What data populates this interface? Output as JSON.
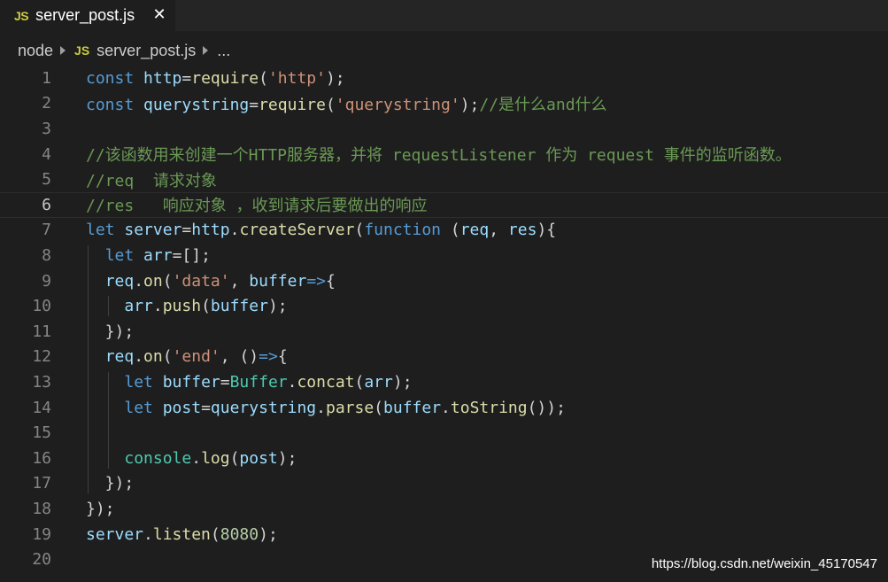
{
  "tab": {
    "badge": "JS",
    "filename": "server_post.js",
    "close_glyph": "✕"
  },
  "breadcrumb": {
    "folder": "node",
    "badge": "JS",
    "file": "server_post.js",
    "more": "..."
  },
  "lines": [
    {
      "n": "1",
      "tokens": [
        [
          "kw",
          "const "
        ],
        [
          "var",
          "http"
        ],
        [
          "pun",
          "="
        ],
        [
          "fn",
          "require"
        ],
        [
          "pun",
          "("
        ],
        [
          "str",
          "'http'"
        ],
        [
          "pun",
          ");"
        ]
      ]
    },
    {
      "n": "2",
      "tokens": [
        [
          "kw",
          "const "
        ],
        [
          "var",
          "querystring"
        ],
        [
          "pun",
          "="
        ],
        [
          "fn",
          "require"
        ],
        [
          "pun",
          "("
        ],
        [
          "str",
          "'querystring'"
        ],
        [
          "pun",
          ");"
        ],
        [
          "cmt",
          "//是什么and什么"
        ]
      ]
    },
    {
      "n": "3",
      "tokens": []
    },
    {
      "n": "4",
      "tokens": [
        [
          "cmt",
          "//该函数用来创建一个HTTP服务器，并将 requestListener 作为 request 事件的监听函数。"
        ]
      ]
    },
    {
      "n": "5",
      "tokens": [
        [
          "cmt",
          "//req  请求对象"
        ]
      ]
    },
    {
      "n": "6",
      "tokens": [
        [
          "cmt",
          "//res   响应对象 ，收到请求后要做出的响应"
        ]
      ]
    },
    {
      "n": "7",
      "tokens": [
        [
          "kw",
          "let "
        ],
        [
          "var",
          "server"
        ],
        [
          "pun",
          "="
        ],
        [
          "var",
          "http"
        ],
        [
          "pun",
          "."
        ],
        [
          "fn",
          "createServer"
        ],
        [
          "pun",
          "("
        ],
        [
          "kw",
          "function"
        ],
        [
          "pun",
          " ("
        ],
        [
          "var",
          "req"
        ],
        [
          "pun",
          ", "
        ],
        [
          "var",
          "res"
        ],
        [
          "pun",
          "){"
        ]
      ]
    },
    {
      "n": "8",
      "tokens": [
        [
          "pun",
          "  "
        ],
        [
          "kw",
          "let "
        ],
        [
          "var",
          "arr"
        ],
        [
          "pun",
          "=[];"
        ]
      ]
    },
    {
      "n": "9",
      "tokens": [
        [
          "pun",
          "  "
        ],
        [
          "var",
          "req"
        ],
        [
          "pun",
          "."
        ],
        [
          "fn",
          "on"
        ],
        [
          "pun",
          "("
        ],
        [
          "str",
          "'data'"
        ],
        [
          "pun",
          ", "
        ],
        [
          "var",
          "buffer"
        ],
        [
          "kw",
          "=>"
        ],
        [
          "pun",
          "{"
        ]
      ]
    },
    {
      "n": "10",
      "tokens": [
        [
          "pun",
          "    "
        ],
        [
          "var",
          "arr"
        ],
        [
          "pun",
          "."
        ],
        [
          "fn",
          "push"
        ],
        [
          "pun",
          "("
        ],
        [
          "var",
          "buffer"
        ],
        [
          "pun",
          ");"
        ]
      ]
    },
    {
      "n": "11",
      "tokens": [
        [
          "pun",
          "  });"
        ]
      ]
    },
    {
      "n": "12",
      "tokens": [
        [
          "pun",
          "  "
        ],
        [
          "var",
          "req"
        ],
        [
          "pun",
          "."
        ],
        [
          "fn",
          "on"
        ],
        [
          "pun",
          "("
        ],
        [
          "str",
          "'end'"
        ],
        [
          "pun",
          ", ()"
        ],
        [
          "kw",
          "=>"
        ],
        [
          "pun",
          "{"
        ]
      ]
    },
    {
      "n": "13",
      "tokens": [
        [
          "pun",
          "    "
        ],
        [
          "kw",
          "let "
        ],
        [
          "var",
          "buffer"
        ],
        [
          "pun",
          "="
        ],
        [
          "cls",
          "Buffer"
        ],
        [
          "pun",
          "."
        ],
        [
          "fn",
          "concat"
        ],
        [
          "pun",
          "("
        ],
        [
          "var",
          "arr"
        ],
        [
          "pun",
          ");"
        ]
      ]
    },
    {
      "n": "14",
      "tokens": [
        [
          "pun",
          "    "
        ],
        [
          "kw",
          "let "
        ],
        [
          "var",
          "post"
        ],
        [
          "pun",
          "="
        ],
        [
          "var",
          "querystring"
        ],
        [
          "pun",
          "."
        ],
        [
          "fn",
          "parse"
        ],
        [
          "pun",
          "("
        ],
        [
          "var",
          "buffer"
        ],
        [
          "pun",
          "."
        ],
        [
          "fn",
          "toString"
        ],
        [
          "pun",
          "());"
        ]
      ]
    },
    {
      "n": "15",
      "tokens": []
    },
    {
      "n": "16",
      "tokens": [
        [
          "pun",
          "    "
        ],
        [
          "cls",
          "console"
        ],
        [
          "pun",
          "."
        ],
        [
          "fn",
          "log"
        ],
        [
          "pun",
          "("
        ],
        [
          "var",
          "post"
        ],
        [
          "pun",
          ");"
        ]
      ]
    },
    {
      "n": "17",
      "tokens": [
        [
          "pun",
          "  });"
        ]
      ]
    },
    {
      "n": "18",
      "tokens": [
        [
          "pun",
          "});"
        ]
      ]
    },
    {
      "n": "19",
      "tokens": [
        [
          "var",
          "server"
        ],
        [
          "pun",
          "."
        ],
        [
          "fn",
          "listen"
        ],
        [
          "pun",
          "("
        ],
        [
          "num",
          "8080"
        ],
        [
          "pun",
          ");"
        ]
      ]
    },
    {
      "n": "20",
      "tokens": []
    }
  ],
  "active_line": "6",
  "watermark": "https://blog.csdn.net/weixin_45170547",
  "colors": {
    "background": "#1e1e1e",
    "keyword": "#569cd6",
    "variable": "#9cdcfe",
    "function": "#dcdcaa",
    "string": "#ce9178",
    "comment": "#6a9955",
    "number": "#b5cea8",
    "class": "#4ec9b0",
    "js_badge": "#cbcb41"
  }
}
